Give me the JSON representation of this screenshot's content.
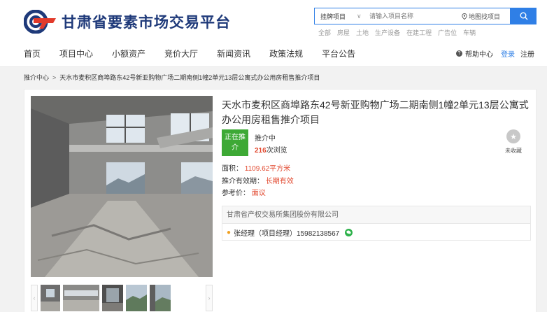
{
  "site": {
    "title": "甘肃省要素市场交易平台",
    "brand_color": "#1f3a7a",
    "accent_color": "#2f7fe6"
  },
  "search": {
    "category": "挂牌项目",
    "placeholder": "请输入项目名称",
    "map_link": "地图找项目",
    "button_icon": "search-icon"
  },
  "quick_tags": [
    "全部",
    "房屋",
    "土地",
    "生产设备",
    "在建工程",
    "广告位",
    "车辆"
  ],
  "nav": {
    "items": [
      "首页",
      "项目中心",
      "小额资产",
      "竞价大厅",
      "新闻资讯",
      "政策法规",
      "平台公告"
    ],
    "help": "帮助中心",
    "login": "登录",
    "register": "注册"
  },
  "breadcrumb": {
    "root": "推介中心",
    "separator": ">",
    "current": "天水市麦积区商埠路东42号新亚购物广场二期南侧1幢2单元13层公寓式办公用房租售推介项目"
  },
  "project": {
    "title": "天水市麦积区商埠路东42号新亚购物广场二期南侧1幢2单元13层公寓式办公用房租售推介项目",
    "status_badge": "正在推介",
    "status_text": "推介中",
    "views_count": "216",
    "views_suffix": "次浏览",
    "favorite_label": "未收藏",
    "area_label": "面积：",
    "area_value": "1109.62平方米",
    "validity_label": "推介有效期：",
    "validity_value": "长期有效",
    "price_label": "参考价：",
    "price_value": "面议",
    "organization": "甘肃省产权交易所集团股份有限公司",
    "contact": "张经理（项目经理）15982138567"
  },
  "gallery": {
    "prev_icon": "chevron-left-icon",
    "next_icon": "chevron-right-icon",
    "thumbnail_count": 5
  }
}
